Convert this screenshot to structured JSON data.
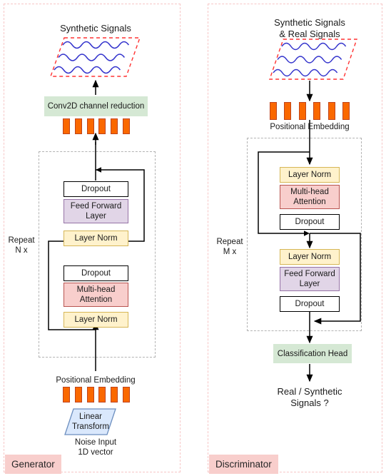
{
  "diagram": {
    "title": "Transformer GAN architecture",
    "colors": {
      "group_border": "#f7c6c6",
      "group_label_bg": "#f8cecc",
      "repeat_border": "#b3b3b3",
      "token_fill": "#fa6800",
      "token_stroke": "#c0441a",
      "layer_norm": "#fff2cc",
      "attention": "#f8cecc",
      "feed_forward": "#e1d5e7",
      "conv_head": "#d5e8d4",
      "linear_transform": "#dae8fc",
      "signal_frame": "#ff3333",
      "signal_wave": "#3333cc"
    }
  },
  "generator": {
    "group_label": "Generator",
    "output_title": "Synthetic Signals",
    "conv_block": "Conv2D channel reduction",
    "tokens_top_count": 6,
    "repeat_label": "Repeat\nN x",
    "blocks": [
      {
        "name": "dropout-2",
        "label": "Dropout",
        "style": "white"
      },
      {
        "name": "feed-forward-layer",
        "label": "Feed Forward\nLayer",
        "style": "purple"
      },
      {
        "name": "layer-norm-2",
        "label": "Layer Norm",
        "style": "yellow"
      },
      {
        "name": "dropout-1",
        "label": "Dropout",
        "style": "white"
      },
      {
        "name": "multi-head-attention",
        "label": "Multi-head\nAttention",
        "style": "red"
      },
      {
        "name": "layer-norm-1",
        "label": "Layer Norm",
        "style": "yellow"
      }
    ],
    "positional_embedding": "Positional Embedding",
    "tokens_bottom_count": 6,
    "linear_transform": "Linear\nTransform",
    "input_label": "Noise Input\n1D vector"
  },
  "discriminator": {
    "group_label": "Discriminator",
    "input_title": "Synthetic Signals\n& Real Signals",
    "tokens_top_count": 6,
    "positional_embedding": "Positional Embedding",
    "repeat_label": "Repeat\nM x",
    "blocks": [
      {
        "name": "layer-norm-1",
        "label": "Layer Norm",
        "style": "yellow"
      },
      {
        "name": "multi-head-attention",
        "label": "Multi-head\nAttention",
        "style": "red"
      },
      {
        "name": "dropout-1",
        "label": "Dropout",
        "style": "white"
      },
      {
        "name": "layer-norm-2",
        "label": "Layer Norm",
        "style": "yellow"
      },
      {
        "name": "feed-forward-layer",
        "label": "Feed Forward\nLayer",
        "style": "purple"
      },
      {
        "name": "dropout-2",
        "label": "Dropout",
        "style": "white"
      }
    ],
    "classification_head": "Classification Head",
    "output_label": "Real / Synthetic\nSignals ?"
  }
}
